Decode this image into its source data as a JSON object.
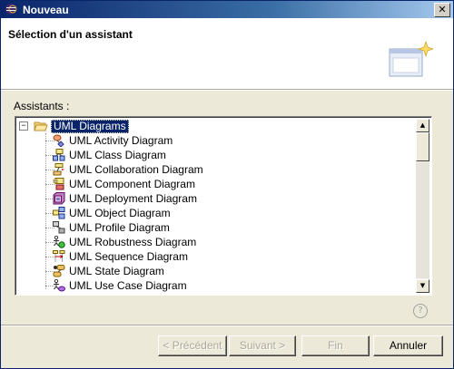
{
  "window": {
    "title": "Nouveau",
    "close_glyph": "✕"
  },
  "header": {
    "title": "Sélection d'un assistant"
  },
  "assistants_label": "Assistants :",
  "tree": {
    "root": {
      "label": "UML Diagrams",
      "expander": "−"
    },
    "items": [
      {
        "label": "UML Activity Diagram",
        "icon": "activity-diagram-icon"
      },
      {
        "label": "UML Class Diagram",
        "icon": "class-diagram-icon"
      },
      {
        "label": "UML Collaboration Diagram",
        "icon": "collaboration-diagram-icon"
      },
      {
        "label": "UML Component Diagram",
        "icon": "component-diagram-icon"
      },
      {
        "label": "UML Deployment Diagram",
        "icon": "deployment-diagram-icon"
      },
      {
        "label": "UML Object Diagram",
        "icon": "object-diagram-icon"
      },
      {
        "label": "UML Profile Diagram",
        "icon": "profile-diagram-icon"
      },
      {
        "label": "UML Robustness Diagram",
        "icon": "robustness-diagram-icon"
      },
      {
        "label": "UML Sequence Diagram",
        "icon": "sequence-diagram-icon"
      },
      {
        "label": "UML State Diagram",
        "icon": "state-diagram-icon"
      },
      {
        "label": "UML Use Case Diagram",
        "icon": "use-case-diagram-icon"
      }
    ]
  },
  "help_glyph": "?",
  "buttons": {
    "previous": "< Précédent",
    "next": "Suivant >",
    "finish": "Fin",
    "cancel": "Annuler"
  },
  "colors": {
    "selection": "#0a246a",
    "dialog_bg": "#ece9d8"
  }
}
